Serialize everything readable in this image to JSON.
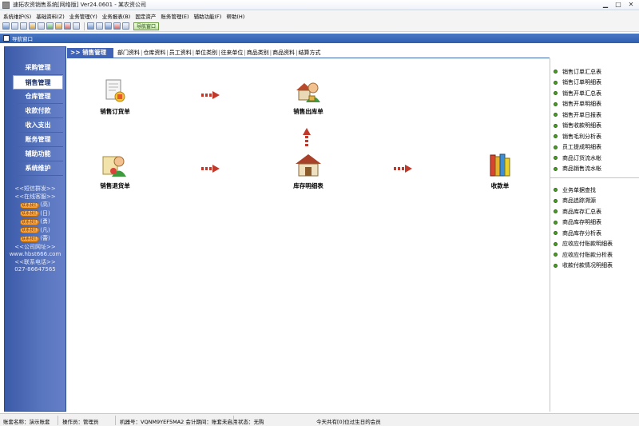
{
  "window": {
    "title": "速拓农资销售系统[网络版] Ver24.0601 - 某农资公司",
    "minimize": "▁",
    "maximize": "□",
    "close": "✕"
  },
  "menu": [
    "系统维护(S)",
    "基础资料(Z)",
    "业务管理(Y)",
    "业务报表(B)",
    "固定资产",
    "账务管理(E)",
    "辅助功能(F)",
    "帮助(H)"
  ],
  "toolbar": {
    "nav_button": "导航窗口"
  },
  "tabstrip": {
    "label": "导航窗口"
  },
  "sidebar": {
    "items": [
      "采购管理",
      "销售管理",
      "仓库管理",
      "收款付款",
      "收入支出",
      "账务管理",
      "辅助功能",
      "系统维护"
    ],
    "active_index": 1,
    "sms": "<<短信群发>>",
    "online": "<<在线客服>>",
    "qq_badge": "联系我们",
    "qq": [
      "(高)",
      "(日)",
      "(勇)",
      "(凡)",
      "(蕾)"
    ],
    "site_title": "<<公司网址>>",
    "site": "www.hbst666.com",
    "phone_title": "<<联系电话>>",
    "phone": "027-86647565"
  },
  "main": {
    "section": ">> 销售管理",
    "links": [
      "部门资料",
      "仓库资料",
      "员工资料",
      "单位类别",
      "往来单位",
      "商品类别",
      "商品资料",
      "结算方式"
    ],
    "nodes": {
      "order": "销售订货单",
      "outbound": "销售出库单",
      "return": "销售退货单",
      "inventory": "库存明细表",
      "receipt": "收款单"
    }
  },
  "reports_top": [
    "销售订单汇总表",
    "销售订单明细表",
    "销售开单汇总表",
    "销售开单明细表",
    "销售开单日报表",
    "销售收款明细表",
    "销售毛利分析表",
    "员工提成明细表",
    "商品订货流水帐",
    "商品销售流水帐"
  ],
  "reports_bottom": [
    "业务单据查找",
    "商品追踪溯源",
    "商品库存汇总表",
    "商品库存明细表",
    "商品库存分析表",
    "应收应付账款明细表",
    "应收应付账款分析表",
    "收款付款情况明细表"
  ],
  "status": {
    "account": "账套名称：演示账套",
    "operator": "操作员：管理员",
    "machine": "机器号：VQNM9YEF5MA2 会计期间：账套未启用",
    "state": "状态：无购",
    "birthday": "今天共有[0]位过生日的会员"
  },
  "colors": {
    "accent": "#3f63b6",
    "sidebar": "#5875bf",
    "arrow": "#c0392b",
    "dot": "#4d9d29"
  }
}
